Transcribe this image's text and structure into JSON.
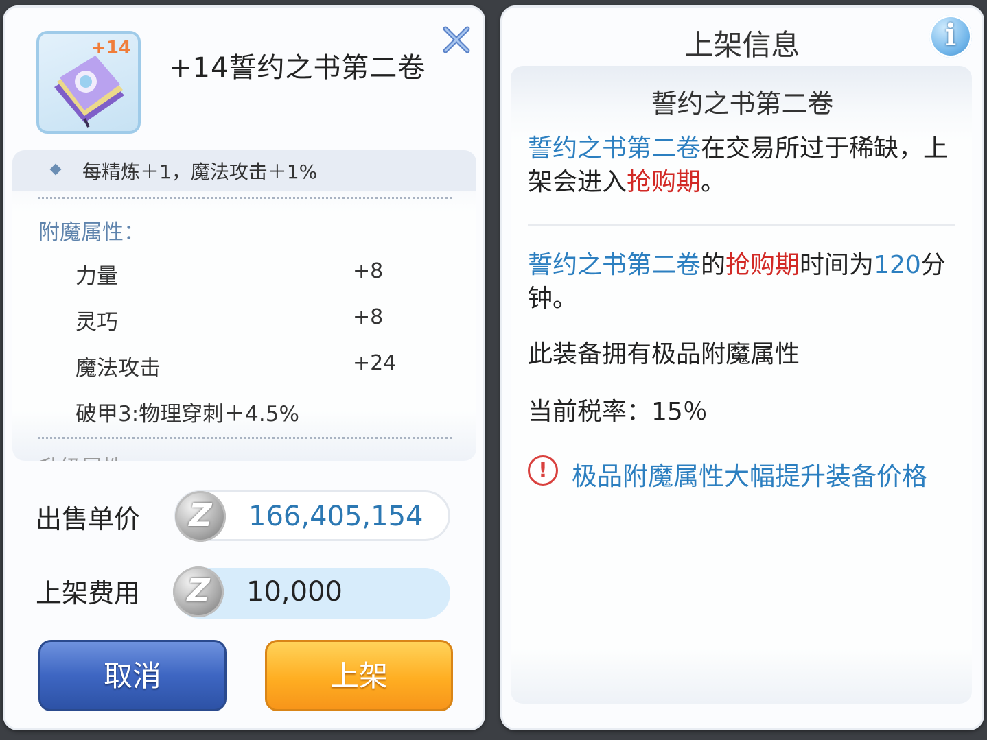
{
  "item": {
    "refine_badge": "+14",
    "title": "+14誓约之书第二卷",
    "refine_bonus": "每精炼＋1，魔法攻击＋1%",
    "enchant_title": "附魔属性：",
    "attributes": [
      {
        "name": "力量",
        "value": "+8"
      },
      {
        "name": "灵巧",
        "value": "+8"
      },
      {
        "name": "魔法攻击",
        "value": "+24"
      },
      {
        "name": "破甲3:物理穿刺＋4.5%",
        "value": ""
      }
    ],
    "cut_off_text": "升级属性"
  },
  "pricing": {
    "unit_price_label": "出售单价",
    "unit_price": "166,405,154",
    "listing_fee_label": "上架费用",
    "listing_fee": "10,000",
    "currency_icon": "Z"
  },
  "buttons": {
    "cancel": "取消",
    "list": "上架"
  },
  "info": {
    "title": "上架信息",
    "info_icon": "i",
    "item_name": "誓约之书第二卷",
    "p1_item": "誓约之书第二卷",
    "p1_mid": "在交易所过于稀缺，上架会进入",
    "p1_red": "抢购期",
    "p1_end": "。",
    "p2_item": "誓约之书第二卷",
    "p2_of": "的",
    "p2_red": "抢购期",
    "p2_mid": "时间为",
    "p2_num": "120",
    "p2_end": "分钟。",
    "p3": "此装备拥有极品附魔属性",
    "tax": "当前税率：15％",
    "warning_icon": "!",
    "warning": "极品附魔属性大幅提升装备价格"
  },
  "colors": {
    "accent_blue": "#2c7fc0",
    "highlight_red": "#d22a26",
    "refine_orange": "#f07d3a",
    "cancel_button": "#3e66c2",
    "list_button": "#ffae22"
  }
}
